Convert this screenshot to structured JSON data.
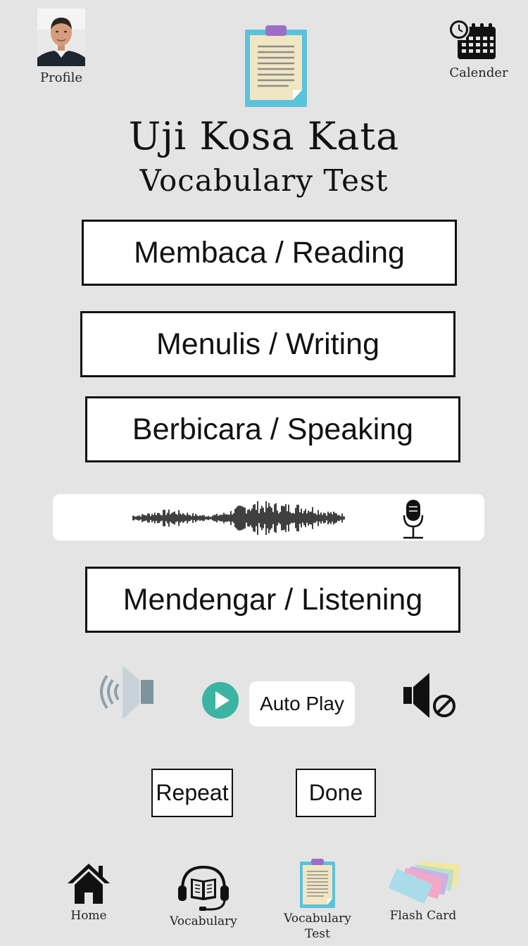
{
  "header": {
    "profile_label": "Profile",
    "calendar_label": "Calender",
    "title_primary": "Uji Kosa Kata",
    "title_secondary": "Vocabulary Test"
  },
  "skills": {
    "reading": "Membaca / Reading",
    "writing": "Menulis / Writing",
    "speaking": "Berbicara / Speaking",
    "listening": "Mendengar / Listening"
  },
  "audio": {
    "auto_play_label": "Auto Play"
  },
  "actions": {
    "repeat_label": "Repeat",
    "done_label": "Done"
  },
  "nav": {
    "home": "Home",
    "vocabulary": "Vocabulary",
    "vocabulary_test_line1": "Vocabulary",
    "vocabulary_test_line2": "Test",
    "flash_card": "Flash Card"
  },
  "colors": {
    "background": "#e4e4e4",
    "play_button": "#3bb4a2",
    "clipboard_board": "#5bc2dc",
    "clipboard_paper": "#f1e6c3",
    "clipboard_clip": "#9b6fc4",
    "speaker_grey": "#8fa0aa"
  },
  "icons": [
    "avatar-photo",
    "clipboard-icon",
    "calendar-icon",
    "waveform-icon",
    "microphone-icon",
    "speaker-volume-icon",
    "play-icon",
    "mute-icon",
    "home-icon",
    "headset-book-icon",
    "flash-cards-icon"
  ]
}
